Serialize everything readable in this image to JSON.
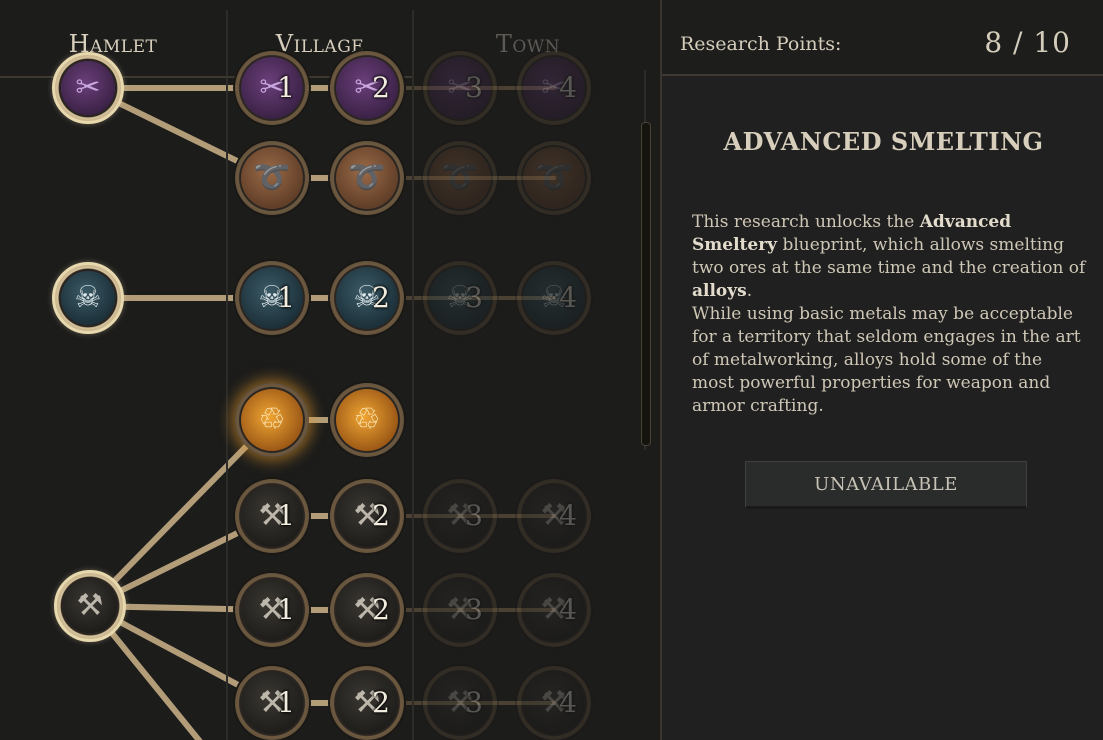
{
  "tiers": [
    {
      "name": "Hamlet",
      "locked": false
    },
    {
      "name": "Village",
      "locked": false
    },
    {
      "name": "Town",
      "locked": true
    }
  ],
  "research_points": {
    "label": "Research Points:",
    "value": "8 / 10"
  },
  "selected": {
    "title": "ADVANCED SMELTING",
    "desc1_prefix": "This research unlocks the ",
    "desc1_bold1": "Advanced Smeltery",
    "desc1_mid": " blueprint, which allows smelting two ores at the same time and the creation of ",
    "desc1_bold2": "alloys",
    "desc1_suffix": ".",
    "desc2": "While using basic metals may be acceptable for a territory that seldom engages in the art of metalworking, alloys hold some of the most powerful properties for weapon and armor crafting.",
    "button": "UNAVAILABLE"
  },
  "tree_rows": [
    {
      "theme": "purple",
      "icon": "scissors-icon",
      "levels": [
        "1",
        "2",
        "3",
        "4"
      ]
    },
    {
      "theme": "leather",
      "icon": "hide-icon",
      "levels": [
        "",
        "",
        "",
        ""
      ]
    },
    {
      "theme": "teal",
      "icon": "ram-skull-icon",
      "levels": [
        "1",
        "2",
        "3",
        "4"
      ]
    },
    {
      "theme": "fire",
      "icon": "smelter-icon",
      "levels": [
        "",
        ""
      ]
    },
    {
      "theme": "iron",
      "icon": "anvil-icon",
      "levels": [
        "1",
        "2",
        "3",
        "4"
      ]
    },
    {
      "theme": "iron",
      "icon": "anvil-icon",
      "levels": [
        "1",
        "2",
        "3",
        "4"
      ]
    },
    {
      "theme": "iron",
      "icon": "anvil-icon",
      "levels": [
        "1",
        "2",
        "3",
        "4"
      ]
    }
  ],
  "colors": {
    "gold_ring": "#cdb88e",
    "bronze_ring": "#8a7252",
    "accent_fire": "#e79a2a"
  }
}
